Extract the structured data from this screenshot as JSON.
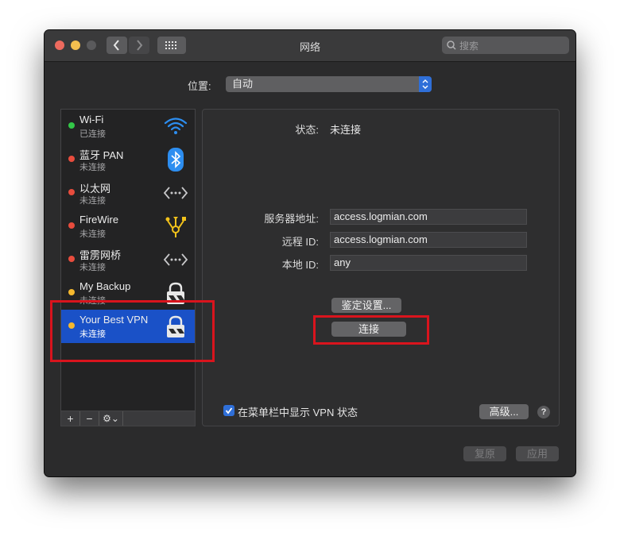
{
  "window": {
    "title": "网络",
    "search_placeholder": "搜索"
  },
  "location": {
    "label": "位置:",
    "value": "自动"
  },
  "services": [
    {
      "name": "Wi-Fi",
      "status": "已连接",
      "dot_color": "#33c748",
      "icon": "wifi-icon"
    },
    {
      "name": "蓝牙 PAN",
      "status": "未连接",
      "dot_color": "#e84c3d",
      "icon": "bluetooth-icon"
    },
    {
      "name": "以太网",
      "status": "未连接",
      "dot_color": "#e84c3d",
      "icon": "ethernet-icon"
    },
    {
      "name": "FireWire",
      "status": "未连接",
      "dot_color": "#e84c3d",
      "icon": "firewire-icon"
    },
    {
      "name": "雷雳网桥",
      "status": "未连接",
      "dot_color": "#e84c3d",
      "icon": "thunderbolt-bridge-icon"
    },
    {
      "name": "My Backup",
      "status": "未连接",
      "dot_color": "#f5b82e",
      "icon": "vpn-lock-icon"
    },
    {
      "name": "Your Best VPN",
      "status": "未连接",
      "dot_color": "#f5b82e",
      "icon": "vpn-lock-icon",
      "selected": true
    }
  ],
  "sidebar_tools": {
    "add": "+",
    "remove": "−",
    "gear": "⚙︎⌄"
  },
  "detail": {
    "status_label": "状态:",
    "status_value": "未连接",
    "server_label": "服务器地址:",
    "server_value": "access.logmian.com",
    "remote_id_label": "远程 ID:",
    "remote_id_value": "access.logmian.com",
    "local_id_label": "本地 ID:",
    "local_id_value": "any",
    "auth_button": "鉴定设置...",
    "connect_button": "连接",
    "show_in_menubar_label": "在菜单栏中显示 VPN 状态",
    "show_in_menubar_checked": true,
    "advanced_button": "高级...",
    "help": "?"
  },
  "footer": {
    "revert": "复原",
    "apply": "应用"
  },
  "colors": {
    "accent": "#1a51c7",
    "highlight_box": "#d9141d"
  }
}
